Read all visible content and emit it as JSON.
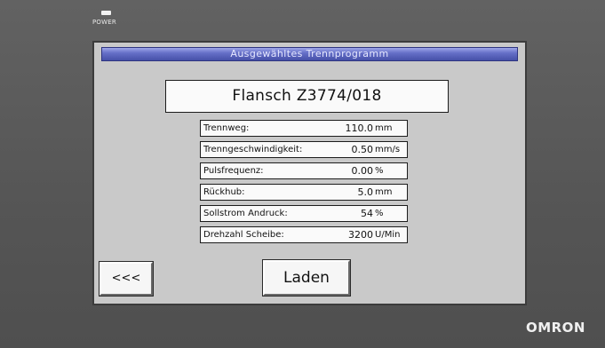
{
  "device": {
    "power_label": "POWER",
    "brand": "OMRON"
  },
  "screen": {
    "title": "Ausgewähltes Trennprogramm",
    "program_name": "Flansch Z3774/018",
    "params": [
      {
        "label": "Trennweg:",
        "value": "110.0",
        "unit": "mm"
      },
      {
        "label": "Trenngeschwindigkeit:",
        "value": "0.50",
        "unit": "mm/s"
      },
      {
        "label": "Pulsfrequenz:",
        "value": "0.00",
        "unit": "%"
      },
      {
        "label": "Rückhub:",
        "value": "5.0",
        "unit": "mm"
      },
      {
        "label": "Sollstrom Andruck:",
        "value": "54",
        "unit": "%"
      },
      {
        "label": "Drehzahl Scheibe:",
        "value": "3200",
        "unit": "U/Min"
      }
    ],
    "back_button": "<<<",
    "load_button": "Laden"
  },
  "colors": {
    "titlebar": "#4650a8",
    "screen_bg": "#c9c9c9",
    "bezel": "#5a5a5a"
  }
}
